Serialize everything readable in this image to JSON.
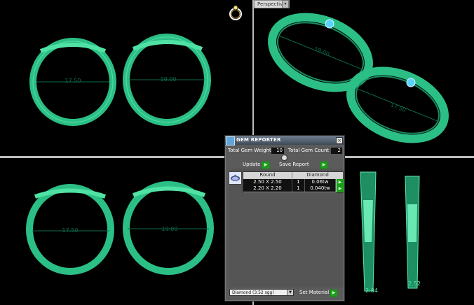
{
  "viewport_top_right": {
    "label": "Perspective",
    "dropdown_glyph": "▾"
  },
  "rings": {
    "top_left": [
      "17.50",
      "19.00"
    ],
    "bottom_left": [
      "17.50",
      "19.00"
    ],
    "top_right": [
      "19.00",
      "17.50"
    ],
    "bottom_right": [
      "2.84",
      "2.52"
    ]
  },
  "gem_reporter": {
    "title": "GEM REPORTER",
    "close_glyph": "×",
    "total_gem_weight_label": "Total Gem Weight",
    "total_gem_weight_value": "10",
    "total_gem_count_label": "Total Gem Count",
    "total_gem_count_value": "2",
    "update_label": "Update",
    "save_report_label": "Save Report",
    "columns": [
      "Round",
      "Diamond"
    ],
    "rows": [
      {
        "size": "2.50 X 2.50",
        "count": "1",
        "weight": "0.06tw"
      },
      {
        "size": "2.20 X 2.20",
        "count": "1",
        "weight": "0.040tw"
      }
    ],
    "material_select": "Diamond    (3.52 sgg)",
    "set_material_label": "Set Material",
    "arrow_glyph": "▶"
  },
  "colors": {
    "ring": "#2bbf86",
    "ring_light": "#6ff0b6",
    "panel": "#5b5b5b",
    "accent_button": "#1e9c1e"
  }
}
